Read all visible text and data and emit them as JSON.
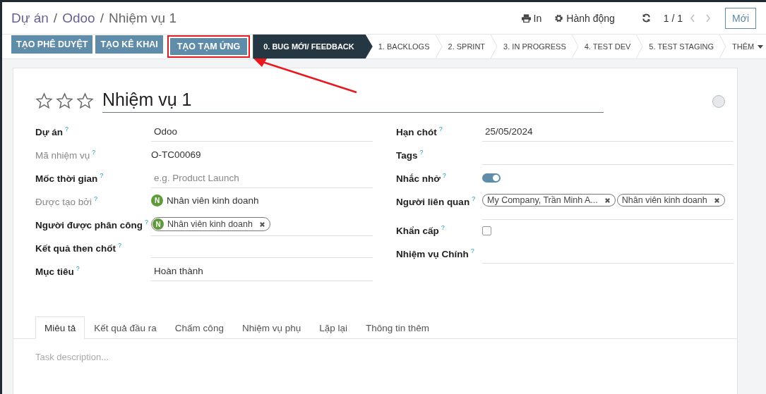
{
  "breadcrumb": [
    {
      "label": "Dự án",
      "kind": "link"
    },
    {
      "label": "Odoo",
      "kind": "link"
    },
    {
      "label": "Nhiệm vụ 1",
      "kind": "current"
    }
  ],
  "breadcrumb_separator": "/",
  "actions": {
    "print": "In",
    "action": "Hành động"
  },
  "pager": {
    "value": "1 / 1"
  },
  "new_button": "Mới",
  "buttons": [
    {
      "label": "TẠO PHÊ DUYỆT",
      "highlighted": false
    },
    {
      "label": "TẠO KÊ KHAI",
      "highlighted": false
    },
    {
      "label": "TẠO TẠM ỨNG",
      "highlighted": true
    }
  ],
  "stages": [
    {
      "label": "0. BUG MỚI/ FEEDBACK",
      "selected": true
    },
    {
      "label": "1. BACKLOGS",
      "selected": false
    },
    {
      "label": "2. SPRINT",
      "selected": false
    },
    {
      "label": "3. IN PROGRESS",
      "selected": false
    },
    {
      "label": "4. TEST DEV",
      "selected": false
    },
    {
      "label": "5. TEST STAGING",
      "selected": false
    }
  ],
  "more_stages": "THÊM",
  "task": {
    "stars": 0,
    "title": "Nhiệm vụ 1"
  },
  "left_fields": [
    {
      "label": "Dự án",
      "help": "?",
      "muted": false,
      "kind": "input",
      "value": "Odoo"
    },
    {
      "label": "Mã nhiệm vụ",
      "help": "?",
      "muted": true,
      "kind": "readonly",
      "value": "O-TC00069"
    },
    {
      "label": "Mốc thời gian",
      "help": "?",
      "muted": false,
      "kind": "input",
      "placeholder": "e.g. Product Launch"
    },
    {
      "label": "Được tạo bởi",
      "help": "?",
      "muted": true,
      "kind": "avatar",
      "avatar": "N",
      "value": "Nhân viên kinh doanh"
    },
    {
      "label": "Người được phân công",
      "help": "?",
      "muted": false,
      "kind": "tags",
      "tags": [
        {
          "avatar": "N",
          "label": "Nhân viên kinh doanh"
        }
      ]
    },
    {
      "label": "Kết quả then chốt",
      "help": "?",
      "muted": false,
      "kind": "input"
    },
    {
      "label": "Mục tiêu",
      "help": "?",
      "muted": false,
      "kind": "input",
      "value": "Hoàn thành"
    }
  ],
  "right_fields": [
    {
      "label": "Hạn chót",
      "help": "?",
      "muted": false,
      "kind": "input",
      "value": "25/05/2024"
    },
    {
      "label": "Tags",
      "help": "?",
      "muted": false,
      "kind": "input"
    },
    {
      "label": "Nhắc nhở",
      "help": "?",
      "muted": false,
      "kind": "toggle",
      "on": true
    },
    {
      "label": "Người liên quan",
      "help": "?",
      "muted": false,
      "kind": "tags",
      "tags": [
        {
          "label": "My Company, Trần Minh A..."
        },
        {
          "label": "Nhân viên kinh doanh"
        }
      ]
    },
    {
      "label": "Khẩn cấp",
      "help": "?",
      "muted": false,
      "kind": "checkbox",
      "checked": false
    },
    {
      "label": "Nhiệm vụ Chính",
      "help": "?",
      "muted": false,
      "kind": "input"
    }
  ],
  "tabs": [
    {
      "label": "Miêu tả",
      "selected": true
    },
    {
      "label": "Kết quả đầu ra",
      "selected": false
    },
    {
      "label": "Chấm công",
      "selected": false
    },
    {
      "label": "Nhiệm vụ phụ",
      "selected": false
    },
    {
      "label": "Lặp lại",
      "selected": false
    },
    {
      "label": "Thông tin thêm",
      "selected": false
    }
  ],
  "description": {
    "placeholder": "Task description..."
  }
}
